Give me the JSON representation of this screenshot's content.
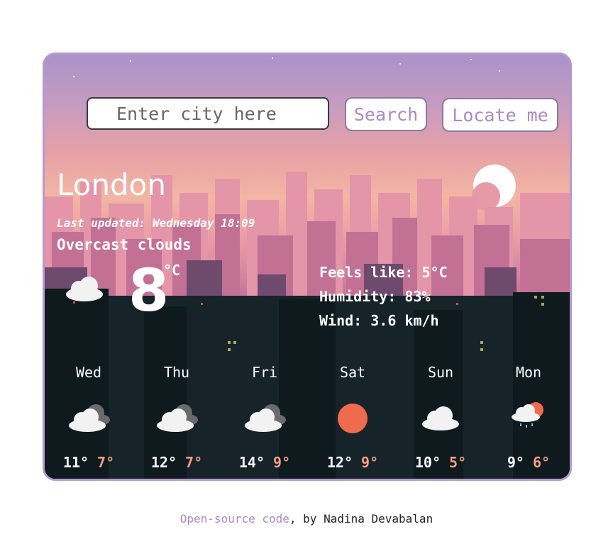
{
  "search": {
    "placeholder": "Enter city here",
    "search_label": "Search",
    "locate_label": "Locate me"
  },
  "current": {
    "city": "London",
    "last_updated": "Last updated: Wednesday 18:09",
    "description": "Overcast clouds",
    "temperature": "8",
    "unit": "°C",
    "icon": "cloud-icon",
    "feels_like": "Feels like: 5°C",
    "humidity": "Humidity: 83%",
    "wind": "Wind: 3.6 km/h"
  },
  "forecast": [
    {
      "day": "Wed",
      "max": "11°",
      "min": "7°",
      "icon": "overcast-clouds-icon"
    },
    {
      "day": "Thu",
      "max": "12°",
      "min": "7°",
      "icon": "overcast-clouds-icon"
    },
    {
      "day": "Fri",
      "max": "14°",
      "min": "9°",
      "icon": "overcast-clouds-icon"
    },
    {
      "day": "Sat",
      "max": "12°",
      "min": "9°",
      "icon": "sun-icon"
    },
    {
      "day": "Sun",
      "max": "10°",
      "min": "5°",
      "icon": "cloud-icon"
    },
    {
      "day": "Mon",
      "max": "9°",
      "min": "6°",
      "icon": "rain-sun-icon"
    }
  ],
  "footer": {
    "link_text": "Open-source code",
    "rest_text": ", by Nadina Devabalan"
  },
  "colors": {
    "accent": "#a889c8",
    "min_temp": "#f59d85",
    "sun": "#ee6b4d"
  }
}
